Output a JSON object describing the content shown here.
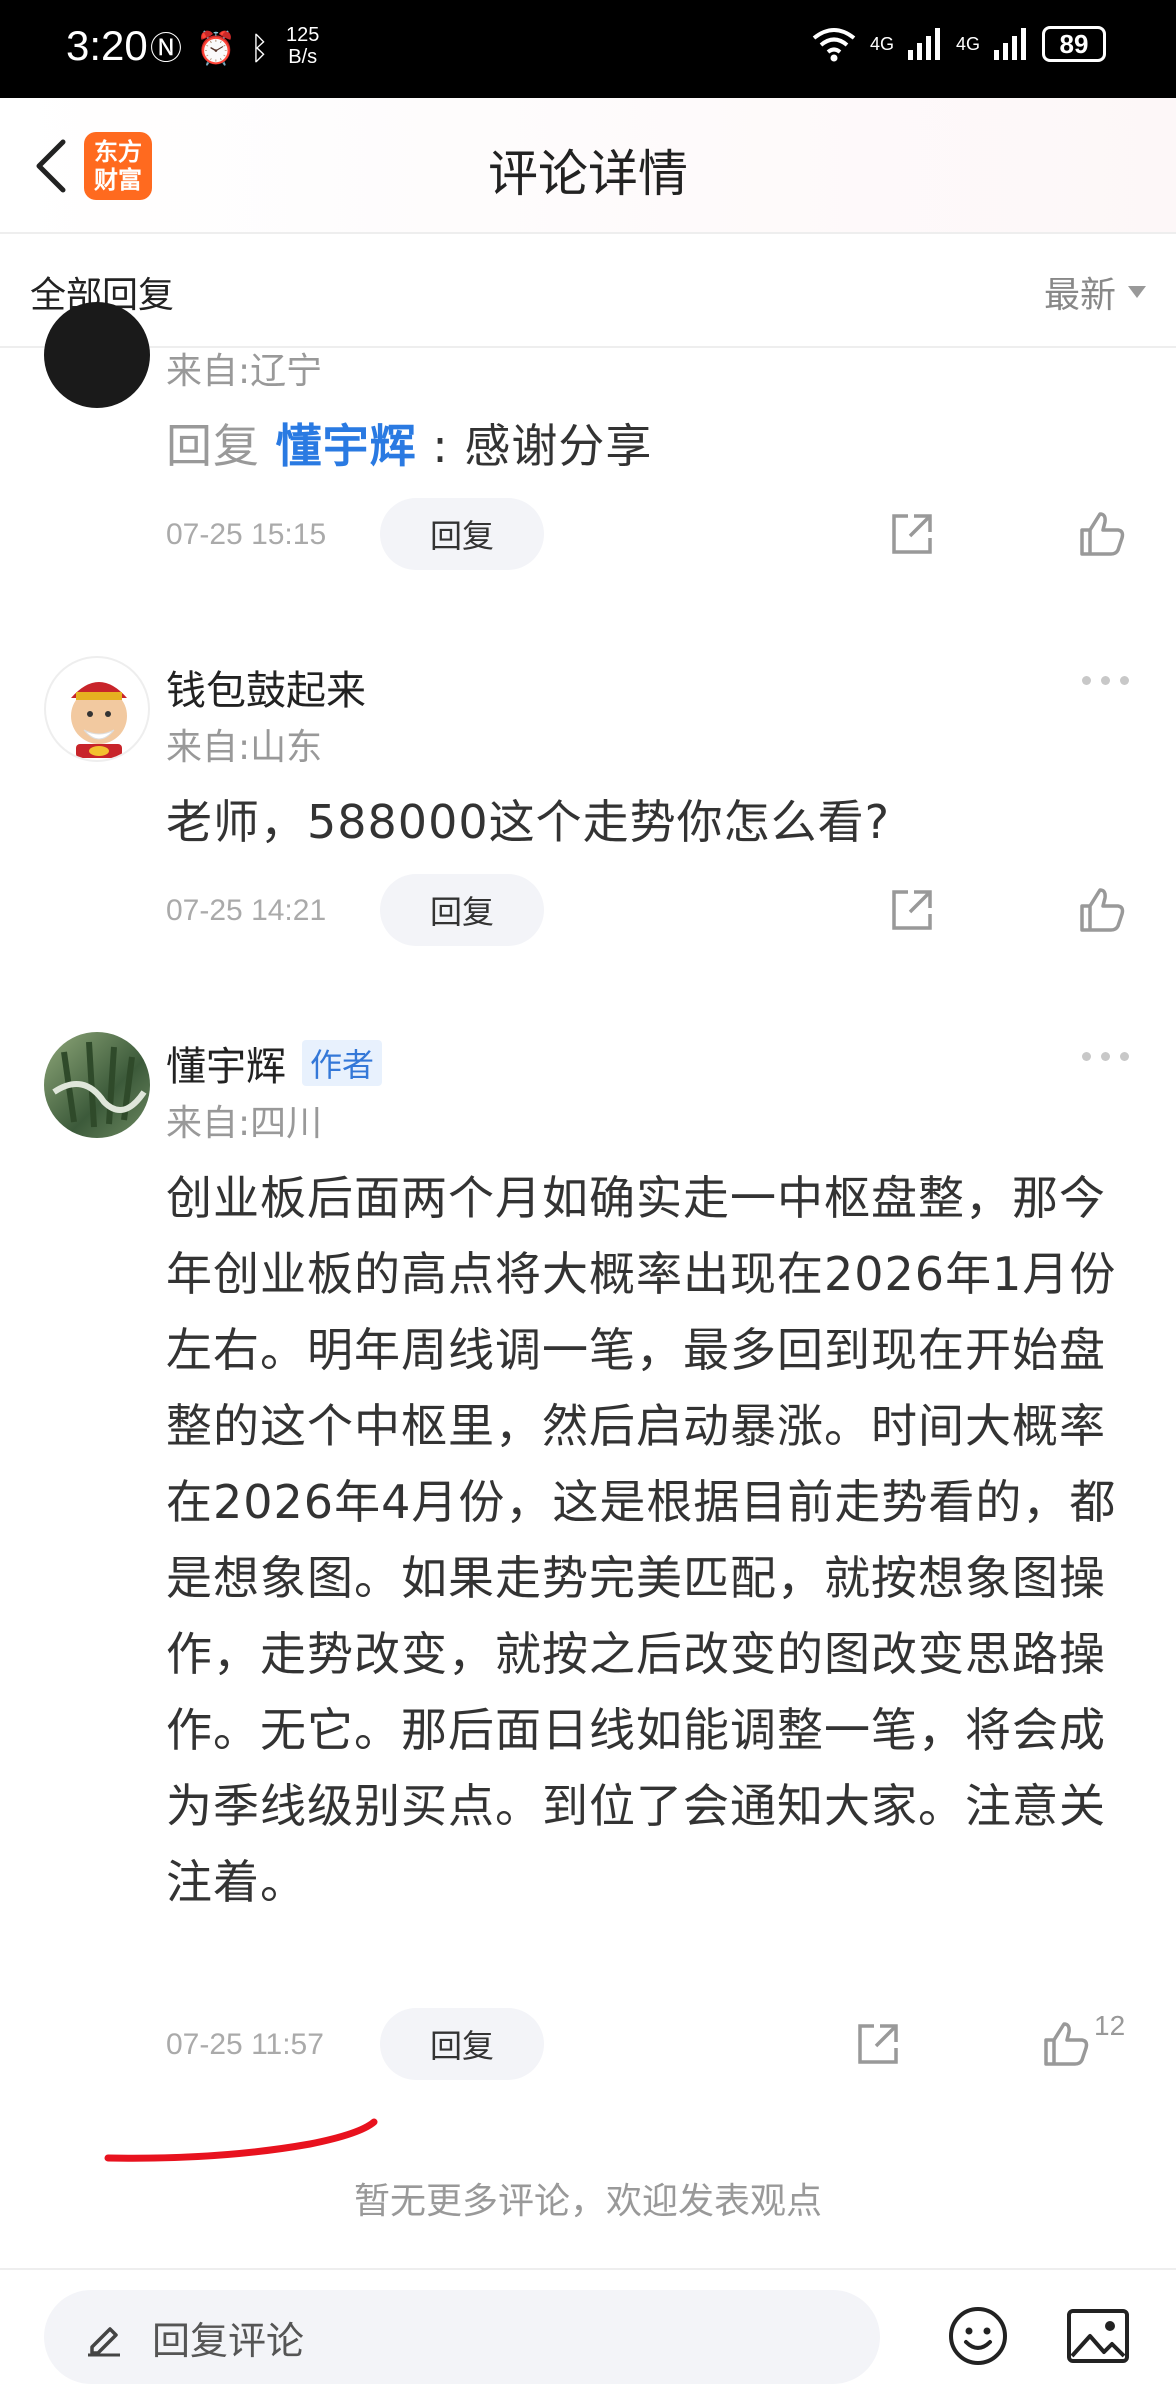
{
  "status_bar": {
    "time": "3:20",
    "speed_value": "125",
    "speed_unit": "B/s",
    "network_1": "4G",
    "network_2": "4G",
    "battery": "89"
  },
  "header": {
    "logo_line1": "东方",
    "logo_line2": "财富",
    "title": "评论详情"
  },
  "filter": {
    "label": "全部回复",
    "sort": "最新"
  },
  "comments": [
    {
      "location": "来自:辽宁",
      "reply_prefix": "回复 ",
      "mention": "懂宇辉",
      "separator": " : ",
      "text": "感谢分享",
      "time": "07-25 15:15",
      "reply_label": "回复"
    },
    {
      "username": "钱包鼓起来",
      "location": "来自:山东",
      "text": "老师，588000这个走势你怎么看?",
      "time": "07-25 14:21",
      "reply_label": "回复"
    },
    {
      "username": "懂宇辉",
      "tag": "作者",
      "location": "来自:四川",
      "text": "创业板后面两个月如确实走一中枢盘整，那今年创业板的高点将大概率出现在2026年1月份左右。明年周线调一笔，最多回到现在开始盘整的这个中枢里，然后启动暴涨。时间大概率在2026年4月份，这是根据目前走势看的，都是想象图。如果走势完美匹配，就按想象图操作，走势改变，就按之后改变的图改变思路操作。无它。那后面日线如能调整一笔，将会成为季线级别买点。到位了会通知大家。注意关注着。",
      "time": "07-25 11:57",
      "reply_label": "回复",
      "likes": "12"
    }
  ],
  "footer": {
    "no_more": "暂无更多评论，欢迎发表观点"
  },
  "bottom_bar": {
    "input_placeholder": "回复评论"
  },
  "colors": {
    "accent_blue": "#2a7ae2",
    "logo_orange": "#ff6a1f",
    "annotation_red": "#e8121e"
  }
}
